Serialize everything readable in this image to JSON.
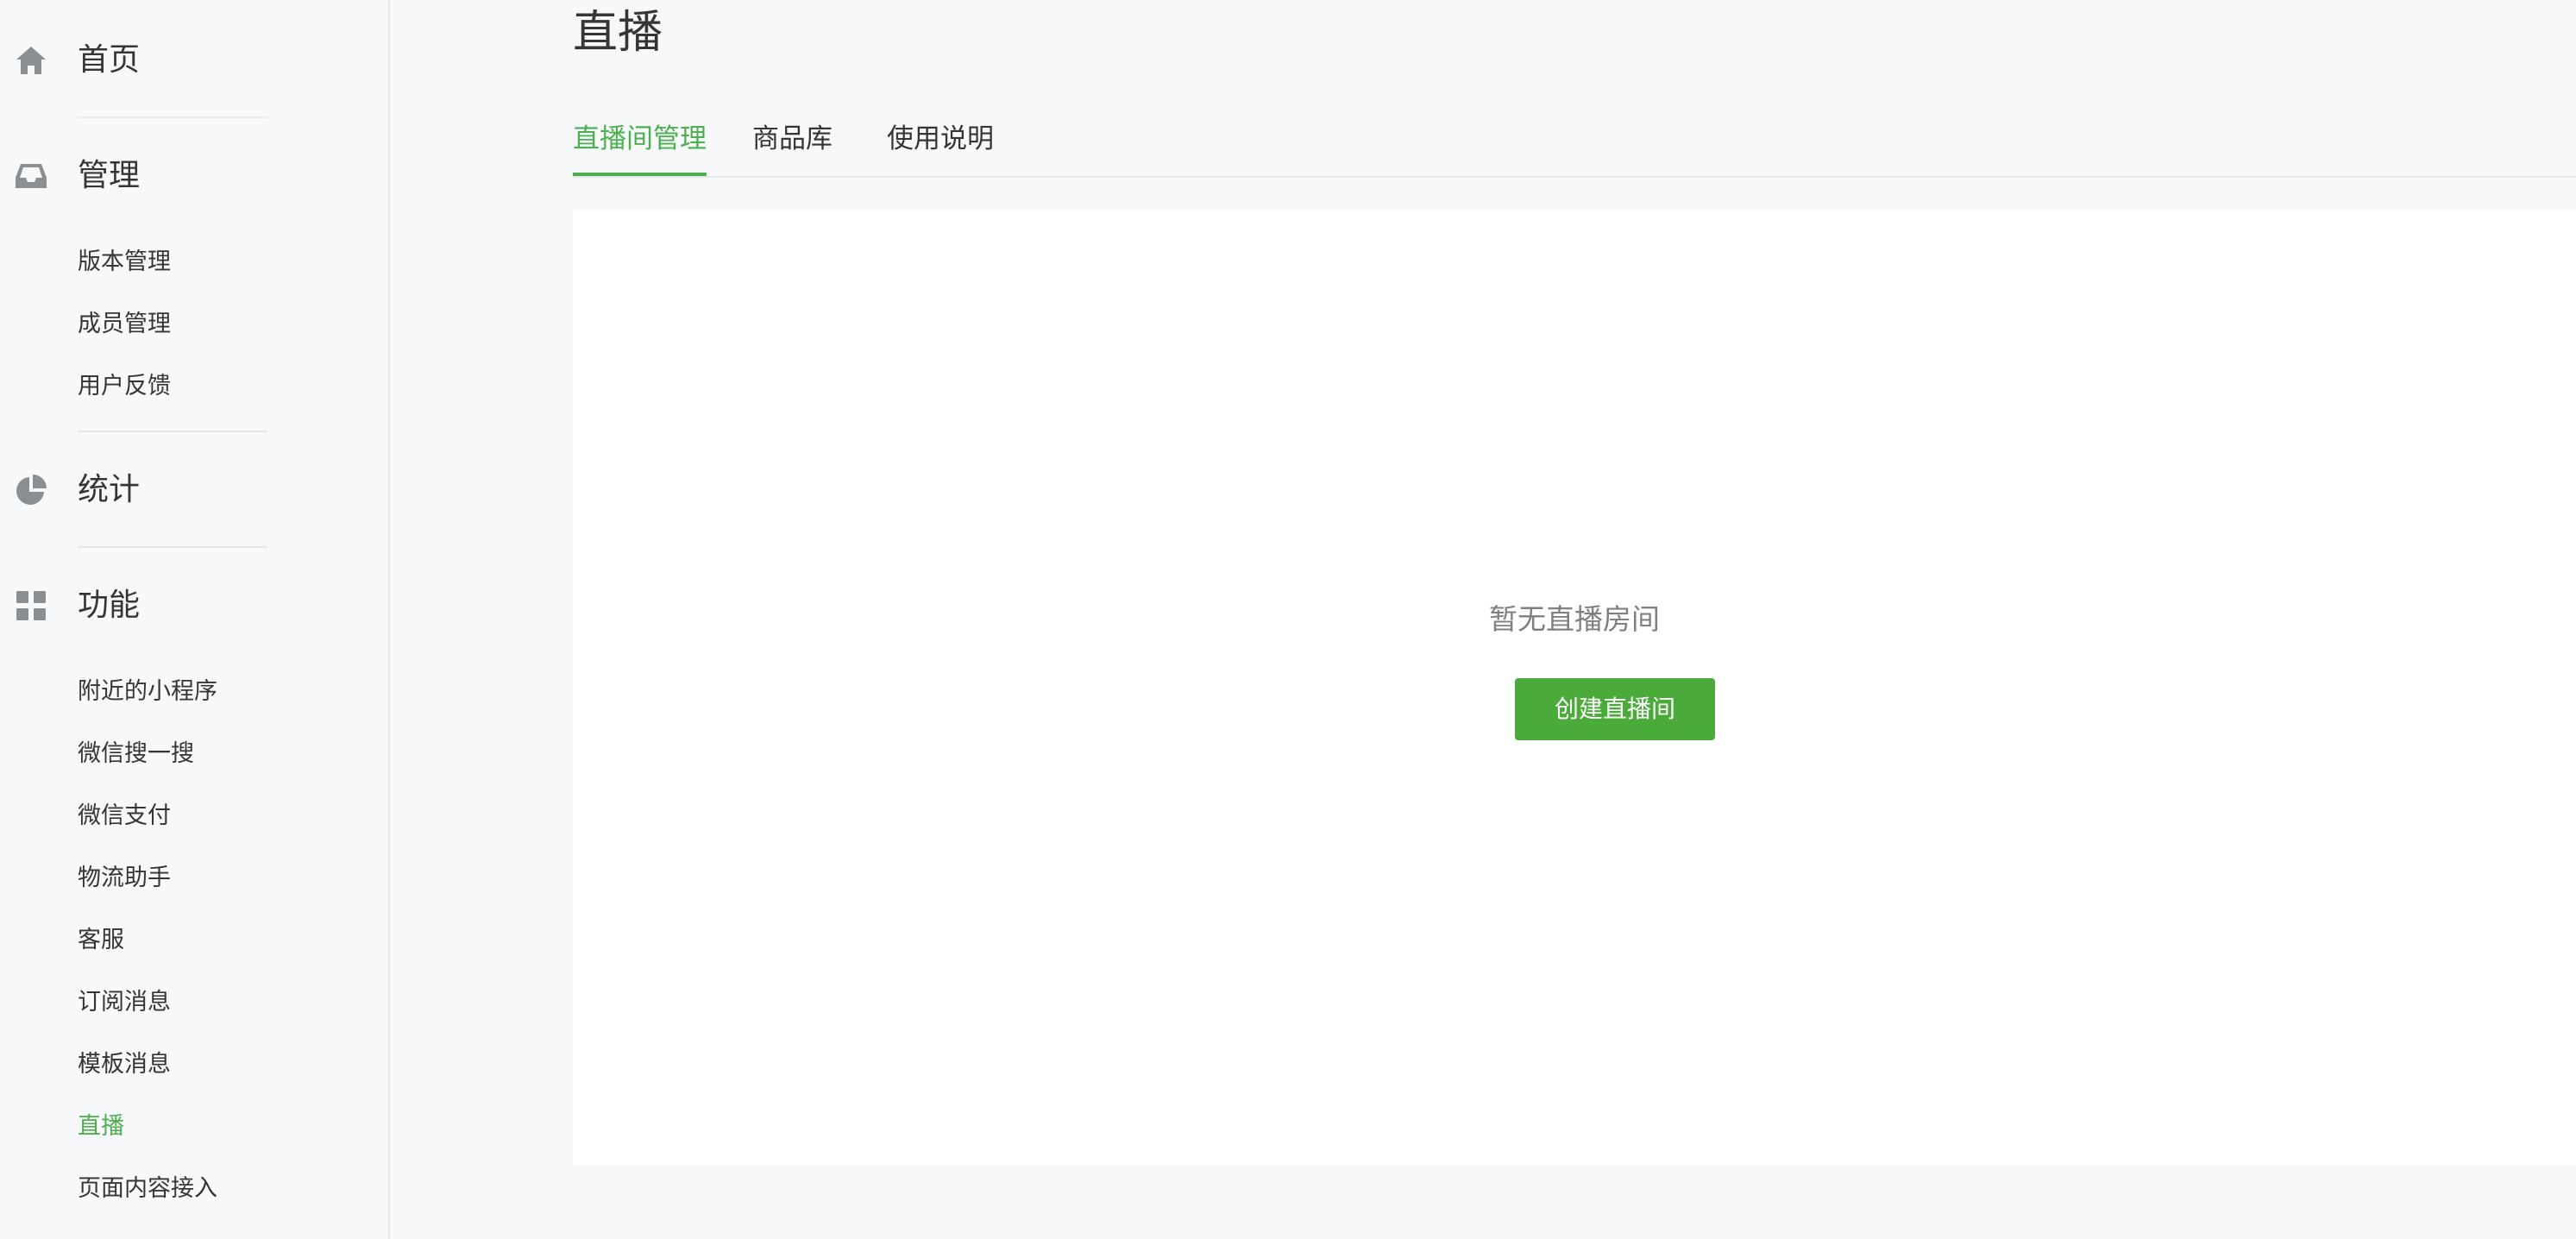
{
  "sidebar": {
    "home": {
      "label": "首页",
      "icon": "home-icon"
    },
    "manage": {
      "label": "管理",
      "icon": "inbox-icon",
      "items": [
        {
          "label": "版本管理"
        },
        {
          "label": "成员管理"
        },
        {
          "label": "用户反馈"
        }
      ]
    },
    "stats": {
      "label": "统计",
      "icon": "pie-chart-icon"
    },
    "features": {
      "label": "功能",
      "icon": "grid-icon",
      "items": [
        {
          "label": "附近的小程序"
        },
        {
          "label": "微信搜一搜"
        },
        {
          "label": "微信支付"
        },
        {
          "label": "物流助手"
        },
        {
          "label": "客服"
        },
        {
          "label": "订阅消息"
        },
        {
          "label": "模板消息"
        },
        {
          "label": "直播",
          "active": true
        },
        {
          "label": "页面内容接入"
        }
      ]
    }
  },
  "main": {
    "title": "直播",
    "tabs": [
      {
        "label": "直播间管理",
        "active": true
      },
      {
        "label": "商品库"
      },
      {
        "label": "使用说明"
      }
    ],
    "empty_text": "暂无直播房间",
    "create_button_label": "创建直播间"
  },
  "colors": {
    "accent": "#4caf50",
    "button": "#4aab3a",
    "text": "#353535",
    "muted": "#808080",
    "background": "#f6f8f9",
    "card": "#ffffff",
    "divider": "#e4e8eb"
  }
}
